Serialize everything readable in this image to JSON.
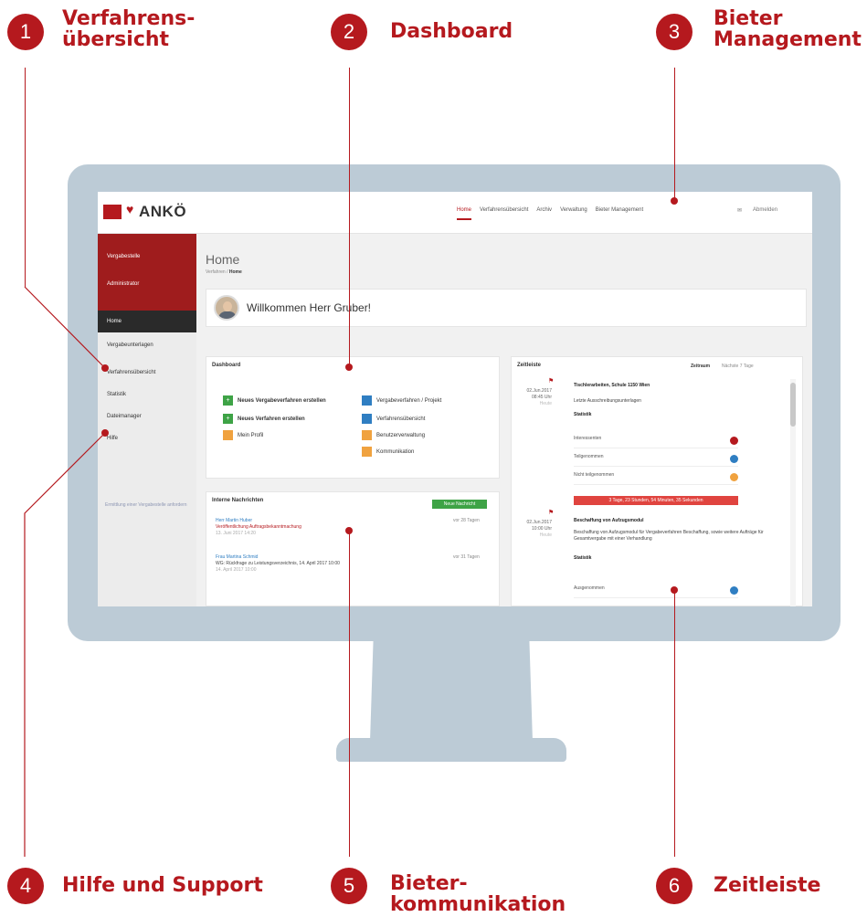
{
  "callouts": [
    {
      "number": "1",
      "label": "Verfahrens-\nübersicht"
    },
    {
      "number": "2",
      "label": "Dashboard"
    },
    {
      "number": "3",
      "label": "Bieter\nManagement"
    },
    {
      "number": "4",
      "label": "Hilfe und Support"
    },
    {
      "number": "5",
      "label": "Bieter-\nkommunikation"
    },
    {
      "number": "6",
      "label": "Zeitleiste"
    }
  ],
  "app": {
    "logo_text": "ANKÖ",
    "nav": [
      "Home",
      "Verfahrensübersicht",
      "Archiv",
      "Verwaltung",
      "Bieter Management"
    ],
    "nav_right": [
      "✉",
      "Abmelden"
    ],
    "sidebar": {
      "user_items": [
        "Vergabestelle",
        "Administrator"
      ],
      "items": [
        "Home",
        "Vergabeunterlagen",
        "Verfahrensübersicht",
        "Statistik",
        "Dateimanager",
        "Hilfe"
      ],
      "footer": "Ermittlung einer Vergabestelle anfordern"
    },
    "page_title": "Home",
    "breadcrumb": {
      "root": "Verfahren",
      "current": "Home"
    },
    "welcome": "Willkommen Herr Gruber!",
    "dashboard": {
      "title": "Dashboard",
      "left": [
        "Neues Vergabeverfahren erstellen",
        "Neues Verfahren erstellen",
        "Mein Profil"
      ],
      "right": [
        "Vergabeverfahren / Projekt",
        "Verfahrensübersicht",
        "Benutzerverwaltung",
        "Kommunikation"
      ]
    },
    "messages": {
      "title": "Interne Nachrichten",
      "new_button": "Neue Nachricht",
      "items": [
        {
          "from": "Herr Martin Huber",
          "subject": "Veröffentlichung Auftragsbekanntmachung",
          "date": "13. Juni 2017 14:20",
          "meta": "vor 28 Tagen"
        },
        {
          "from": "Frau Martina Schmid",
          "subject": "WG: Rückfrage zu Leistungsverzeichnis, 14. April 2017 10:00",
          "date": "14. April 2017 10:00",
          "meta": "vor 31 Tagen"
        }
      ]
    },
    "timeline": {
      "title": "Zeitleiste",
      "filter_label": "Zeitraum",
      "filter_value": "Nächste 7 Tage",
      "entries": [
        {
          "date": "02.Jun.2017",
          "time": "08:45 Uhr",
          "ago": "Heute",
          "title": "Tischlerarbeiten, Schule 1150 Wien",
          "desc": "Letzte Ausschreibungsunterlagen",
          "section": "Statistik",
          "rows": [
            "Interessenten",
            "Teilgenommen",
            "Nicht teilgenommen"
          ],
          "countdown": "3 Tage, 23 Stunden, 54 Minuten, 35 Sekunden"
        },
        {
          "date": "02.Jun.2017",
          "time": "10:00 Uhr",
          "ago": "Heute",
          "title": "Beschaffung von Aufzugsmodul",
          "desc": "Beschaffung von Aufzugsmodul für Vergabeverfahren Beschaffung, sowie weitere Aufträge für Gesamtvergabe mit einer Verhandlung",
          "section": "Statistik",
          "rows": [
            "Ausgenommen"
          ]
        }
      ]
    }
  },
  "colors": {
    "accent": "#b5191e",
    "monitor": "#bccbd6",
    "green": "#3ea346",
    "blue": "#2f7ec2",
    "orange": "#f0a23f"
  }
}
